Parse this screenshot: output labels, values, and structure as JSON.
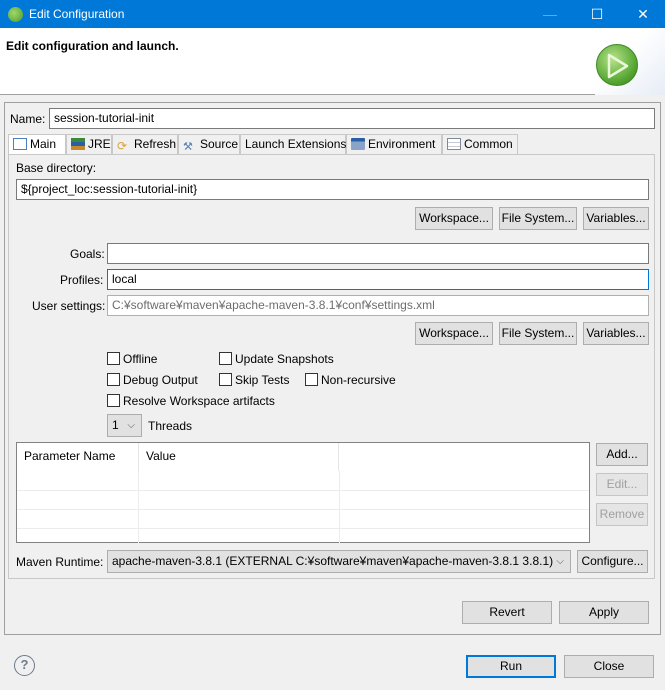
{
  "window": {
    "title": "Edit Configuration",
    "minimize": "—",
    "maximize": "☐",
    "close": "✕"
  },
  "header": {
    "title": "Edit configuration and launch."
  },
  "name": {
    "label": "Name:",
    "value": "session-tutorial-init"
  },
  "tabs": [
    {
      "label": "Main",
      "icon": "main-tab-icon",
      "active": true
    },
    {
      "label": "JRE",
      "icon": "jre-icon"
    },
    {
      "label": "Refresh",
      "icon": "refresh-icon"
    },
    {
      "label": "Source",
      "icon": "source-icon"
    },
    {
      "label": "Launch Extensions",
      "icon": ""
    },
    {
      "label": "Environment",
      "icon": "environment-icon"
    },
    {
      "label": "Common",
      "icon": "common-icon"
    }
  ],
  "main": {
    "base_dir_label": "Base directory:",
    "base_dir_value": "${project_loc:session-tutorial-init}",
    "workspace_btn": "Workspace...",
    "filesystem_btn": "File System...",
    "variables_btn": "Variables...",
    "goals_label": "Goals:",
    "goals_value": "",
    "profiles_label": "Profiles:",
    "profiles_value": "local",
    "user_settings_label": "User settings:",
    "user_settings_value": "C:¥software¥maven¥apache-maven-3.8.1¥conf¥settings.xml",
    "checkboxes": {
      "offline": {
        "label": "Offline",
        "checked": false
      },
      "update_snapshots": {
        "label": "Update Snapshots",
        "checked": false
      },
      "debug_output": {
        "label": "Debug Output",
        "checked": false
      },
      "skip_tests": {
        "label": "Skip Tests",
        "checked": false
      },
      "non_recursive": {
        "label": "Non-recursive",
        "checked": false
      },
      "resolve_workspace": {
        "label": "Resolve Workspace artifacts",
        "checked": false
      }
    },
    "threads_value": "1",
    "threads_label": "Threads",
    "table": {
      "columns": [
        "Parameter Name",
        "Value"
      ],
      "rows": []
    },
    "add_btn": "Add...",
    "edit_btn": "Edit...",
    "remove_btn": "Remove",
    "maven_runtime_label": "Maven Runtime:",
    "maven_runtime_value": "apache-maven-3.8.1 (EXTERNAL C:¥software¥maven¥apache-maven-3.8.1 3.8.1)",
    "configure_btn": "Configure..."
  },
  "footer": {
    "revert_btn": "Revert",
    "apply_btn": "Apply",
    "run_btn": "Run",
    "close_btn": "Close",
    "help_icon": "?"
  }
}
